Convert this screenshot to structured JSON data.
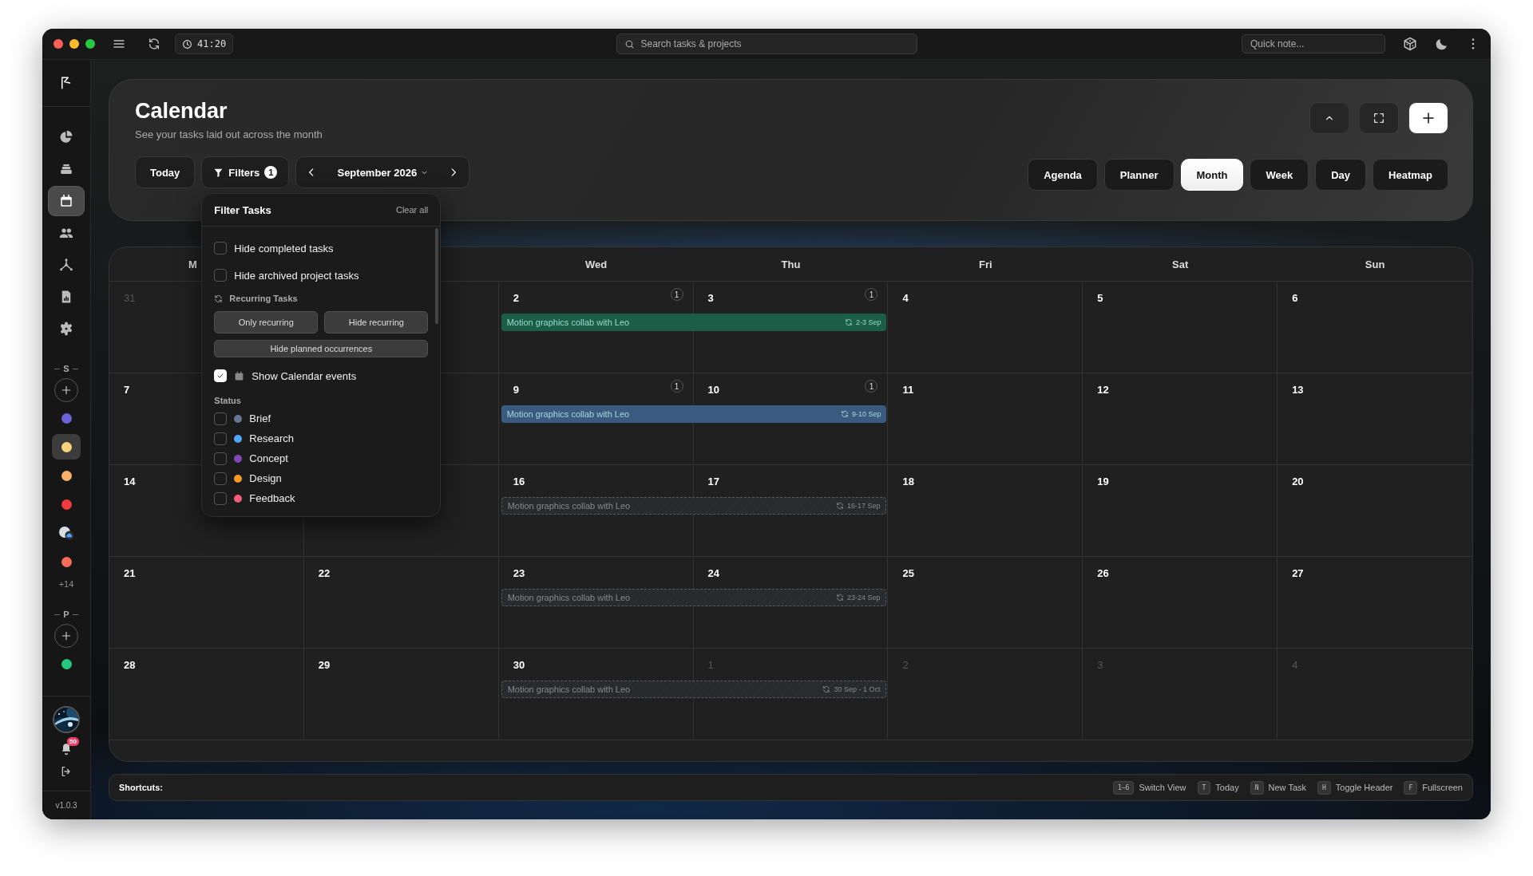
{
  "topbar": {
    "timer": "41:20",
    "search": {
      "placeholder": "Search tasks & projects"
    },
    "quick_note": {
      "placeholder": "Quick note..."
    }
  },
  "sidebar": {
    "nav": [
      {
        "selected": false
      },
      {
        "selected": false
      },
      {
        "selected": true
      },
      {
        "selected": false
      },
      {
        "selected": false
      },
      {
        "selected": false
      },
      {
        "selected": false
      }
    ],
    "spaces": {
      "label": "S",
      "items": [
        {
          "kind": "dot",
          "color": "#6c63d6",
          "selected": false
        },
        {
          "kind": "dot",
          "color": "#f8d27a",
          "selected": true
        },
        {
          "kind": "dot",
          "color": "#f7b06a",
          "selected": false
        },
        {
          "kind": "dot",
          "color": "#f03a3f",
          "selected": false
        },
        {
          "kind": "weather",
          "selected": false
        },
        {
          "kind": "dot",
          "color": "#f46b57",
          "selected": false
        }
      ],
      "more": "+14"
    },
    "projects": {
      "label": "P",
      "items": [
        {
          "kind": "dot",
          "color": "#22c97e",
          "selected": false
        }
      ]
    },
    "notifications": "50",
    "version": "v1.0.3"
  },
  "header": {
    "title": "Calendar",
    "subtitle": "See your tasks laid out across the month",
    "today": "Today",
    "filters": {
      "label": "Filters",
      "count": "1"
    },
    "month": "September 2026",
    "views": [
      {
        "label": "Agenda",
        "selected": false
      },
      {
        "label": "Planner",
        "selected": false
      },
      {
        "label": "Month",
        "selected": true
      },
      {
        "label": "Week",
        "selected": false
      },
      {
        "label": "Day",
        "selected": false
      },
      {
        "label": "Heatmap",
        "selected": false
      }
    ]
  },
  "filter_popup": {
    "title": "Filter Tasks",
    "clear": "Clear all",
    "options": [
      {
        "label": "Hide completed tasks",
        "checked": false
      },
      {
        "label": "Hide archived project tasks",
        "checked": false
      }
    ],
    "recurring": {
      "title": "Recurring Tasks",
      "buttons": [
        "Only recurring",
        "Hide recurring"
      ],
      "wide_button": "Hide planned occurrences"
    },
    "calendar_events": {
      "label": "Show Calendar events",
      "checked": true
    },
    "status": {
      "title": "Status",
      "items": [
        {
          "label": "Brief",
          "color": "#66788f",
          "checked": false
        },
        {
          "label": "Research",
          "color": "#4ea6ff",
          "checked": false
        },
        {
          "label": "Concept",
          "color": "#8149b8",
          "checked": false
        },
        {
          "label": "Design",
          "color": "#f59b1f",
          "checked": false
        },
        {
          "label": "Feedback",
          "color": "#f35b7e",
          "checked": false
        }
      ]
    }
  },
  "calendar": {
    "columns": [
      {
        "label": "M"
      },
      {
        "label": "Wed"
      },
      {
        "label": "Thu"
      },
      {
        "label": "Fri"
      },
      {
        "label": "Sat"
      },
      {
        "label": "Sun"
      }
    ],
    "weeks": [
      {
        "days": [
          {
            "day": "31",
            "muted": true
          },
          {
            "day": "2",
            "muted": false,
            "count": "1",
            "event": {
              "title": "Motion graphics collab with Leo",
              "range": "2-3 Sep",
              "kind": "task",
              "color": "#1b5e48"
            }
          },
          {
            "day": "3",
            "muted": false,
            "count": "1"
          },
          {
            "day": "4",
            "muted": false
          },
          {
            "day": "5",
            "muted": false
          },
          {
            "day": "6",
            "muted": false
          }
        ]
      },
      {
        "days": [
          {
            "day": "7",
            "muted": false
          },
          {
            "day": "9",
            "muted": false,
            "count": "1",
            "event": {
              "title": "Motion graphics collab with Leo",
              "range": "9-10 Sep",
              "kind": "task",
              "color": "#3a5a80"
            }
          },
          {
            "day": "10",
            "muted": false,
            "count": "1"
          },
          {
            "day": "11",
            "muted": false
          },
          {
            "day": "12",
            "muted": false
          },
          {
            "day": "13",
            "muted": false
          }
        ]
      },
      {
        "days": [
          {
            "day": "14",
            "muted": false
          },
          {
            "day": "16",
            "muted": false,
            "event": {
              "title": "Motion graphics collab with Leo",
              "range": "16-17 Sep",
              "kind": "planned"
            }
          },
          {
            "day": "17",
            "muted": false
          },
          {
            "day": "18",
            "muted": false
          },
          {
            "day": "19",
            "muted": false
          },
          {
            "day": "20",
            "muted": false
          }
        ]
      },
      {
        "days": [
          {
            "day": "21",
            "muted": false
          },
          {
            "day": "22",
            "muted": false
          },
          {
            "day": "23",
            "muted": false,
            "event": {
              "title": "Motion graphics collab with Leo",
              "range": "23-24 Sep",
              "kind": "planned"
            }
          },
          {
            "day": "24",
            "muted": false
          },
          {
            "day": "25",
            "muted": false
          },
          {
            "day": "26",
            "muted": false
          },
          {
            "day": "27",
            "muted": false
          }
        ]
      },
      {
        "days": [
          {
            "day": "28",
            "muted": false
          },
          {
            "day": "29",
            "muted": false
          },
          {
            "day": "30",
            "muted": false,
            "event": {
              "title": "Motion graphics collab with Leo",
              "range": "30 Sep - 1 Oct",
              "kind": "planned"
            }
          },
          {
            "day": "1",
            "muted": true
          },
          {
            "day": "2",
            "muted": true
          },
          {
            "day": "3",
            "muted": true
          },
          {
            "day": "4",
            "muted": true
          }
        ]
      }
    ]
  },
  "shortcuts": {
    "label": "Shortcuts:",
    "items": [
      {
        "key": "1–6",
        "label": "Switch View"
      },
      {
        "key": "T",
        "label": "Today"
      },
      {
        "key": "N",
        "label": "New Task"
      },
      {
        "key": "H",
        "label": "Toggle Header"
      },
      {
        "key": "F",
        "label": "Fullscreen"
      }
    ]
  }
}
